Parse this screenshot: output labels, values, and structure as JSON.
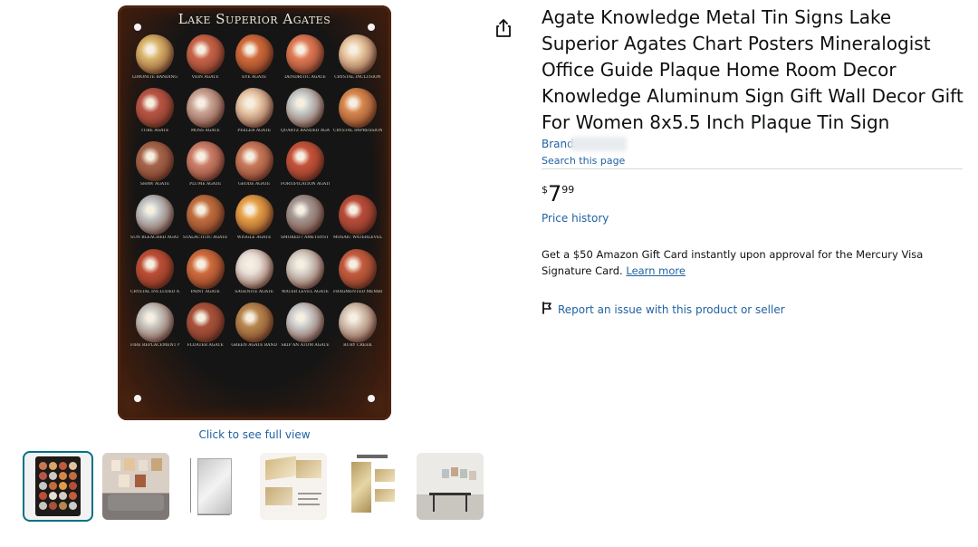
{
  "gallery": {
    "poster_title": "Lake Superior Agates",
    "agates": [
      {
        "label": "Limonite Banding",
        "color": "#d9b46a"
      },
      {
        "label": "Vein Agate",
        "color": "#c8644a"
      },
      {
        "label": "Eye Agate",
        "color": "#d06a3a"
      },
      {
        "label": "Dendritic Agate",
        "color": "#e07a55"
      },
      {
        "label": "Crystal Inclusion",
        "color": "#e8c7a0"
      },
      {
        "label": "Tube Agate",
        "color": "#b85545"
      },
      {
        "label": "Moss Agate",
        "color": "#c9a596"
      },
      {
        "label": "Peeler Agate",
        "color": "#e9c9a9"
      },
      {
        "label": "Quartz Banded Agate",
        "color": "#c6cbc9"
      },
      {
        "label": "Crystal Impressions",
        "color": "#d8884e"
      },
      {
        "label": "Shaw Agate",
        "color": "#a5654b"
      },
      {
        "label": "Plume Agate",
        "color": "#cd7f6a"
      },
      {
        "label": "Geode Agate",
        "color": "#c97a5a"
      },
      {
        "label": "Fortification Agate",
        "color": "#c6533a"
      },
      {
        "label": "",
        "color": "#000000"
      },
      {
        "label": "Sun Bleached Agate",
        "color": "#c0c4c4"
      },
      {
        "label": "Stalactitic Agate",
        "color": "#c06f3e"
      },
      {
        "label": "Wiggle Agate",
        "color": "#e6a046"
      },
      {
        "label": "Smoked / Amethyst Agate",
        "color": "#a39893"
      },
      {
        "label": "Mosaic Waterlevel",
        "color": "#b94c3a"
      },
      {
        "label": "Crystal Included Agate",
        "color": "#bd4d35"
      },
      {
        "label": "Paint Agate",
        "color": "#d06b3c"
      },
      {
        "label": "Sagenite Agate",
        "color": "#e8dfd8"
      },
      {
        "label": "Water Level Agate",
        "color": "#d7d1c9"
      },
      {
        "label": "Fragmented Membrane Agate",
        "color": "#c45c3e"
      },
      {
        "label": "Fire Replacement Agate",
        "color": "#c8c6c1"
      },
      {
        "label": "Floater Agate",
        "color": "#a8523b"
      },
      {
        "label": "Green Agate Band",
        "color": "#b7864e"
      },
      {
        "label": "Skip An Atom Agate",
        "color": "#cbcccc"
      },
      {
        "label": "Ruby Creek",
        "color": "#d6c6b5"
      }
    ],
    "click_text": "Click to see full view",
    "thumbnails": [
      {
        "name": "poster",
        "selected": true
      },
      {
        "name": "room-wall",
        "selected": false
      },
      {
        "name": "dimensions",
        "selected": false
      },
      {
        "name": "plaques",
        "selected": false
      },
      {
        "name": "style",
        "selected": false
      },
      {
        "name": "dining-room",
        "selected": false
      }
    ]
  },
  "icons": {
    "share": "share-icon",
    "flag": "flag-icon"
  },
  "product": {
    "title": "Agate Knowledge Metal Tin Signs Lake Superior Agates Chart Posters Mineralogist Office Guide Plaque Home Room Decor Knowledge Aluminum Sign Gift Wall Decor Gift For Women 8x5.5 Inch Plaque Tin Sign",
    "brand_prefix": "Brand",
    "search_page": "Search this page",
    "price_symbol": "$",
    "price_whole": "7",
    "price_fraction": "99",
    "price_history": "Price history",
    "promo_text": "Get a $50 Amazon Gift Card instantly upon approval for the Mercury Visa Signature Card.",
    "promo_link": "Learn more",
    "report_text": "Report an issue with this product or seller"
  },
  "colors": {
    "link": "#2162a1",
    "selected_thumb_border": "#007185",
    "text": "#0f1111"
  }
}
